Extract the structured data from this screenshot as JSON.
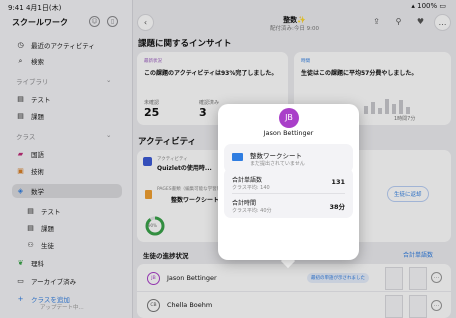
{
  "status_bar": {
    "time": "9:41",
    "date": "4月1日(木)",
    "battery": "100%"
  },
  "sidebar": {
    "title": "スクールワーク",
    "top_items": [
      {
        "icon": "clock-icon",
        "label": "最近のアクティビティ"
      },
      {
        "icon": "search-icon",
        "label": "検索"
      }
    ],
    "library_label": "ライブラリ",
    "library_items": [
      {
        "icon": "doc-icon",
        "label": "テスト"
      },
      {
        "icon": "doc-icon",
        "label": "課題"
      }
    ],
    "class_label": "クラス",
    "classes": [
      {
        "icon": "book-icon",
        "label": "国語",
        "color": "#c0307a"
      },
      {
        "icon": "cpu-icon",
        "label": "技術",
        "color": "#d9822b"
      },
      {
        "icon": "layers-icon",
        "label": "数学",
        "color": "#2f7de1"
      }
    ],
    "math_sub": [
      {
        "icon": "doc-icon",
        "label": "テスト"
      },
      {
        "icon": "doc-icon",
        "label": "課題"
      },
      {
        "icon": "people-icon",
        "label": "生徒"
      }
    ],
    "science": {
      "icon": "leaf-icon",
      "label": "理科",
      "color": "#3aa44a"
    },
    "archive": {
      "icon": "archive-icon",
      "label": "アーカイブ済み"
    },
    "add_class": "クラスを追加",
    "update": "アップデート中..."
  },
  "header": {
    "title": "整数",
    "star": "✨",
    "subtitle": "配付済み:今日 9:00"
  },
  "insights": {
    "heading": "課題に関するインサイト",
    "card1": {
      "tag": "最新状況",
      "text": "この課題のアクティビティは93%完了しました。",
      "stats": [
        {
          "value": "25",
          "label": "未確認"
        },
        {
          "value": "3",
          "label": "確認済み"
        }
      ]
    },
    "card2": {
      "tag": "時間",
      "text": "生徒はこの課題に平均57分費やしました。",
      "axis_label": "1時間7分"
    }
  },
  "activity": {
    "heading": "アクティビティ",
    "items": [
      {
        "tag": "アクティビティ",
        "title": "Quizletの使用時..."
      },
      {
        "tag": "PAGES書類（編集可能な学習用...）",
        "title": "整数ワークシート"
      }
    ],
    "donut_label": "90%",
    "return_button": "生徒に返却"
  },
  "progress": {
    "heading": "生徒の進捗状況",
    "total_link": "合計単語数",
    "students": [
      {
        "initials": "JB",
        "name": "Jason Bettinger",
        "status": "最初の単語が示されました"
      },
      {
        "initials": "CB",
        "name": "Chella Boehm",
        "status": ""
      }
    ]
  },
  "popup": {
    "initials": "JB",
    "name": "Jason Bettinger",
    "doc_title": "整数ワークシート",
    "doc_sub": "まだ提出されていません",
    "rows": [
      {
        "label": "合計単語数",
        "sub": "クラス平均: 140",
        "value": "131"
      },
      {
        "label": "合計時間",
        "sub": "クラス平均: 40分",
        "value": "38分"
      }
    ]
  }
}
